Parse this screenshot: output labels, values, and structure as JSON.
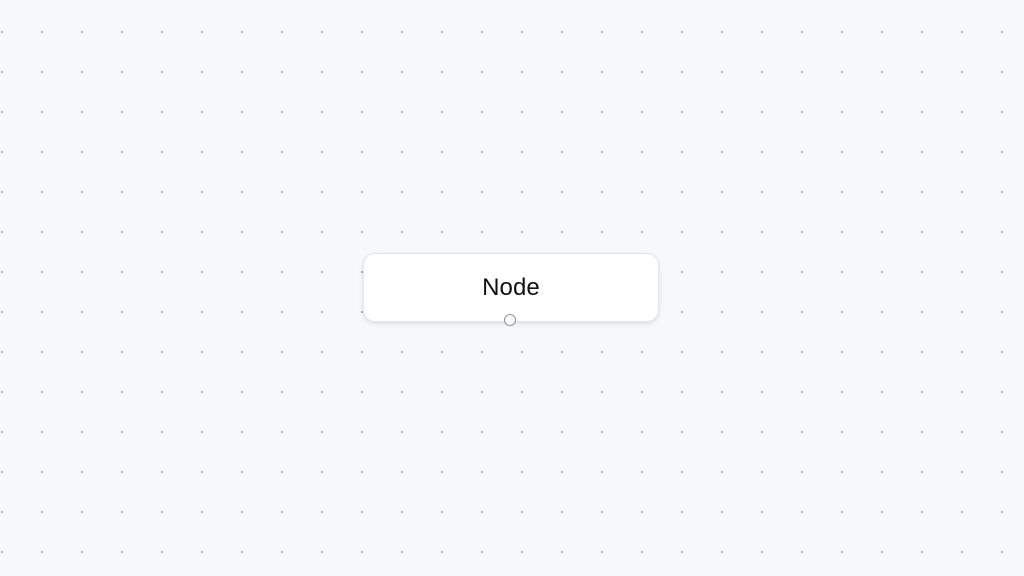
{
  "canvas": {
    "background_color": "#f7f8fa",
    "grid_dot_color": "#a9abb0",
    "grid": "dots"
  },
  "nodes": [
    {
      "label": "Node",
      "handles": [
        {
          "type": "source",
          "side": "bottom"
        }
      ]
    }
  ]
}
